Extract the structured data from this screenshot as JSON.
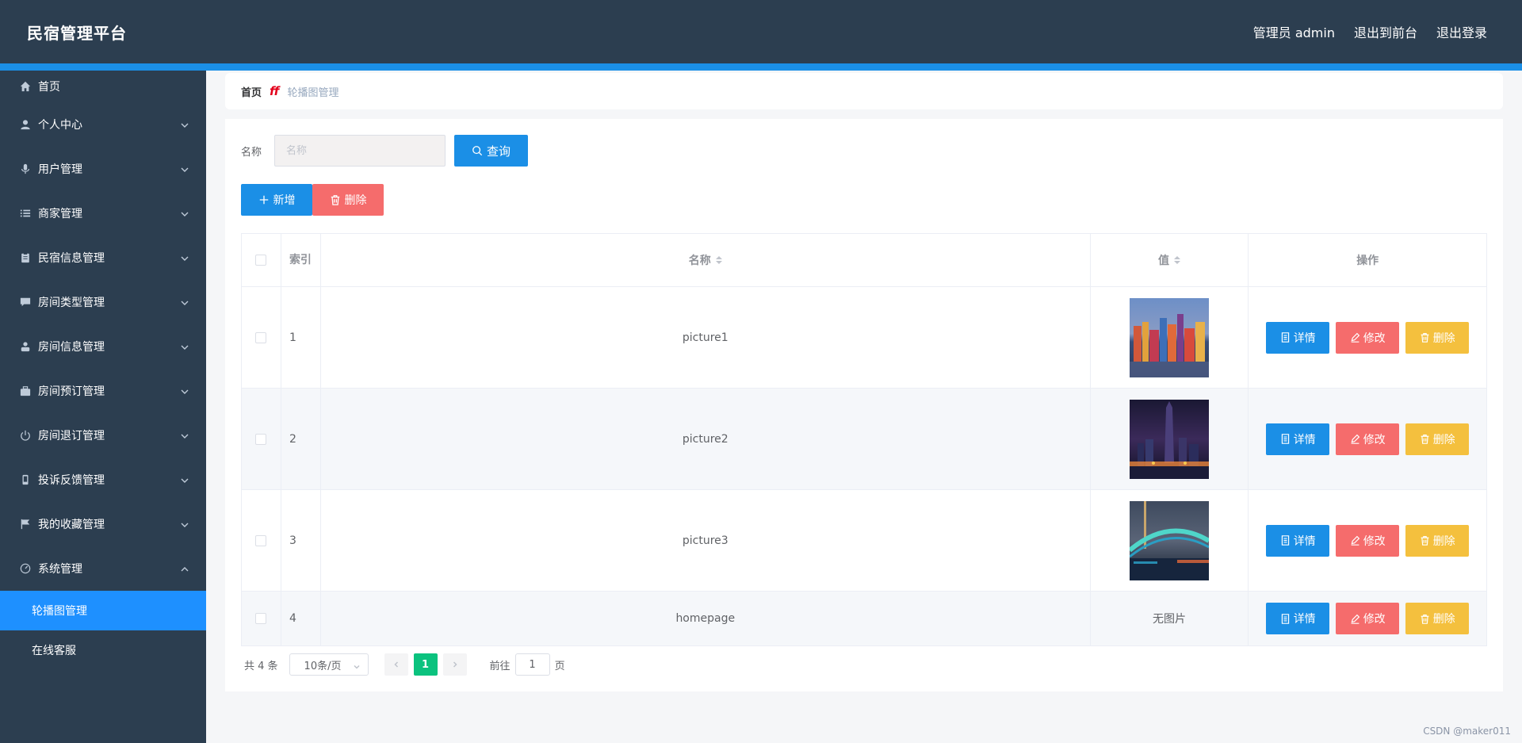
{
  "header": {
    "brand": "民宿管理平台",
    "user": "管理员 admin",
    "to_front": "退出到前台",
    "logout": "退出登录"
  },
  "sidebar": {
    "items": [
      {
        "label": "首页",
        "icon": "home-icon"
      },
      {
        "label": "个人中心",
        "icon": "user-icon"
      },
      {
        "label": "用户管理",
        "icon": "microphone-icon"
      },
      {
        "label": "商家管理",
        "icon": "list-icon"
      },
      {
        "label": "民宿信息管理",
        "icon": "clipboard-icon"
      },
      {
        "label": "房间类型管理",
        "icon": "chat-icon"
      },
      {
        "label": "房间信息管理",
        "icon": "person-icon"
      },
      {
        "label": "房间预订管理",
        "icon": "briefcase-icon"
      },
      {
        "label": "房间退订管理",
        "icon": "power-icon"
      },
      {
        "label": "投诉反馈管理",
        "icon": "phone-icon"
      },
      {
        "label": "我的收藏管理",
        "icon": "flag-icon"
      },
      {
        "label": "系统管理",
        "icon": "gauge-icon"
      }
    ],
    "sub_items": [
      "轮播图管理",
      "在线客服"
    ]
  },
  "breadcrumb": {
    "home": "首页",
    "separator": "ff",
    "current": "轮播图管理"
  },
  "search": {
    "label": "名称",
    "placeholder": "名称",
    "button": "查询"
  },
  "actions": {
    "add": "新增",
    "delete": "删除"
  },
  "table": {
    "headers": {
      "index": "索引",
      "name": "名称",
      "value": "值",
      "ops": "操作"
    },
    "rows": [
      {
        "index": "1",
        "name": "picture1",
        "value": "",
        "image": "city-harbor"
      },
      {
        "index": "2",
        "name": "picture2",
        "value": "",
        "image": "city-night-tower"
      },
      {
        "index": "3",
        "name": "picture3",
        "value": "",
        "image": "bridge-night"
      },
      {
        "index": "4",
        "name": "homepage",
        "value": "无图片",
        "image": ""
      }
    ],
    "buttons": {
      "detail": "详情",
      "edit": "修改",
      "delete": "删除"
    }
  },
  "pager": {
    "total": "共 4 条",
    "page_size": "10条/页",
    "current": "1",
    "goto_prefix": "前往",
    "goto_value": "1",
    "goto_suffix": "页"
  },
  "watermark": "CSDN @maker011",
  "colors": {
    "header_bg": "#2c3e50",
    "accent_blue": "#1b8fe6",
    "danger": "#f56c6c",
    "warning": "#f4c03e",
    "pager_active": "#0bc27e"
  }
}
